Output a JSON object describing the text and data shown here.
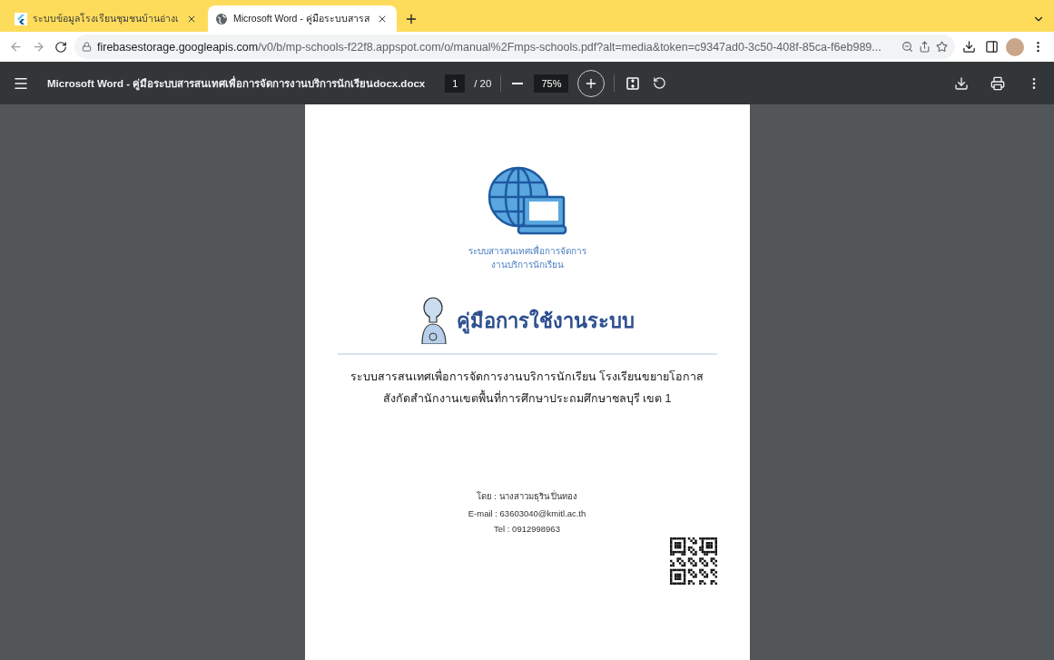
{
  "browser": {
    "tabs": [
      {
        "title": "ระบบข้อมูลโรงเรียนชุมชนบ้านอ่างเ",
        "kind": "flutter",
        "selected": false
      },
      {
        "title": "Microsoft Word - คู่มือระบบสารส",
        "kind": "globe",
        "selected": true
      }
    ],
    "url": {
      "host": "firebasestorage.googleapis.com",
      "path": "/v0/b/mp-schools-f22f8.appspot.com/o/manual%2Fmps-schools.pdf?alt=media&token=c9347ad0-3c50-408f-85ca-f6eb989..."
    }
  },
  "pdf_toolbar": {
    "title": "Microsoft Word - คู่มือระบบสารสนเทศเพื่อการจัดการงานบริการนักเรียนdocx.docx",
    "page": "1",
    "total": "/ 20",
    "zoom": "75%"
  },
  "document": {
    "logo_caption": [
      "ระบบสารสนเทศเพื่อการจัดการ",
      "งานบริการนักเรียน"
    ],
    "heading": "คู่มือการใช้งานระบบ",
    "subtitle": [
      "ระบบสารสนเทศเพื่อการจัดการงานบริการนักเรียน โรงเรียนขยายโอกาส",
      "สังกัดสำนักงานเขตพื้นที่การศึกษาประถมศึกษาชลบุรี เขต 1"
    ],
    "author": "โดย : นางสาวมธุริน ปิ่นทอง",
    "email": "E-mail : 63603040@kmitl.ac.th",
    "tel": "Tel : 0912998963"
  }
}
